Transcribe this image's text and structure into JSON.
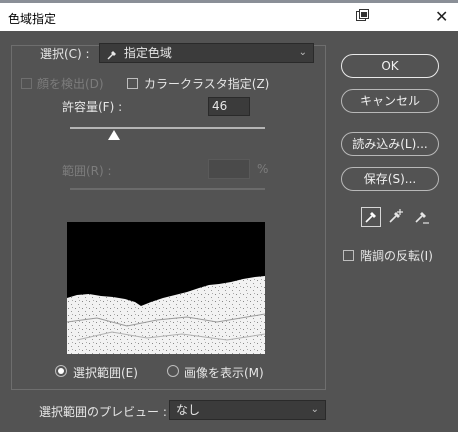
{
  "window": {
    "title": "色域指定"
  },
  "select": {
    "label": "選択(C) :",
    "value": "指定色域"
  },
  "options": {
    "detect_faces": "顔を検出(D)",
    "localized_clusters": "カラークラスタ指定(Z)"
  },
  "fuzziness": {
    "label": "許容量(F) :",
    "value": "46"
  },
  "range": {
    "label": "範囲(R) :",
    "value": "",
    "unit": "%"
  },
  "preview_mode": {
    "selection": "選択範囲(E)",
    "image": "画像を表示(M)",
    "selected": "selection"
  },
  "selection_preview": {
    "label": "選択範囲のプレビュー :",
    "value": "なし"
  },
  "buttons": {
    "ok": "OK",
    "cancel": "キャンセル",
    "load": "読み込み(L)...",
    "save": "保存(S)..."
  },
  "eyedroppers": [
    "eyedropper-icon",
    "eyedropper-plus-icon",
    "eyedropper-minus-icon"
  ],
  "invert": {
    "label": "階調の反転(I)"
  },
  "colors": {
    "panel": "#535353",
    "field": "#3b3b3b",
    "text": "#e6e6e6"
  }
}
